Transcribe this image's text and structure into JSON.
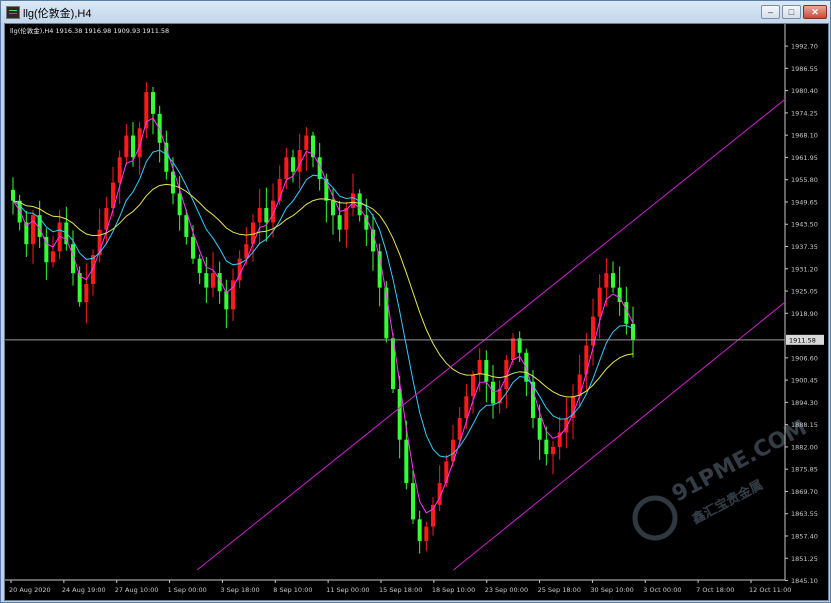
{
  "window": {
    "title": "llg(伦敦金),H4",
    "controls": {
      "minimize": "–",
      "maximize": "□",
      "close": "✕"
    }
  },
  "chart_info": "llg(伦敦金),H4  1916.38 1916.98 1909.93 1911.58",
  "current_price_label": "1911.58",
  "watermark": {
    "brand": "91PME.COM",
    "sub": "鑫汇宝贵金属"
  },
  "colors": {
    "bull": "#ff1a1a",
    "bear": "#33ff33",
    "ma_fast": "#ff33ff",
    "ma_mid": "#33ccff",
    "ma_slow": "#e6e64d",
    "channel": "#cc22cc",
    "price_line": "#9a9a9a"
  },
  "chart_data": {
    "type": "candlestick",
    "symbol": "llg(伦敦金)",
    "timeframe": "H4",
    "ohlc_last": {
      "open": 1916.38,
      "high": 1916.98,
      "low": 1909.93,
      "close": 1911.58
    },
    "ylim": [
      1845.25,
      1998.25
    ],
    "y_ticks": [
      1992.7,
      1986.55,
      1980.4,
      1974.25,
      1968.1,
      1961.95,
      1955.8,
      1949.65,
      1943.5,
      1937.35,
      1931.2,
      1925.05,
      1918.9,
      1906.6,
      1900.45,
      1894.3,
      1888.15,
      1882.0,
      1875.85,
      1869.7,
      1863.55,
      1857.4,
      1851.25,
      1845.1
    ],
    "y_tick_labels": [
      "1992.70",
      "1986.55",
      "1980.40",
      "1974.25",
      "1968.10",
      "1961.95",
      "1955.80",
      "1949.65",
      "1943.50",
      "1937.35",
      "1931.20",
      "1925.05",
      "1918.90",
      "1906.60",
      "1900.45",
      "1894.30",
      "1888.15",
      "1882.00",
      "1875.85",
      "1869.70",
      "1863.55",
      "1857.40",
      "1851.25",
      "1845.10"
    ],
    "x_labels": [
      "20 Aug 2020",
      "24 Aug 19:00",
      "27 Aug 10:00",
      "1 Sep 00:00",
      "3 Sep 18:00",
      "8 Sep 10:00",
      "11 Sep 00:00",
      "15 Sep 18:00",
      "18 Sep 10:00",
      "23 Sep 00:00",
      "25 Sep 18:00",
      "30 Sep 10:00",
      "3 Oct 00:00",
      "7 Oct 18:00",
      "12 Oct 11:00"
    ],
    "closes": [
      1950,
      1944,
      1938,
      1946,
      1940,
      1933,
      1936,
      1944,
      1938,
      1930,
      1922,
      1927,
      1935,
      1942,
      1948,
      1955,
      1962,
      1968,
      1962,
      1970,
      1980,
      1974,
      1966,
      1958,
      1952,
      1946,
      1940,
      1934,
      1930,
      1926,
      1930,
      1925,
      1920,
      1928,
      1934,
      1938,
      1944,
      1948,
      1944,
      1950,
      1956,
      1962,
      1958,
      1964,
      1968,
      1962,
      1956,
      1950,
      1946,
      1942,
      1948,
      1952,
      1946,
      1942,
      1936,
      1926,
      1912,
      1898,
      1884,
      1872,
      1862,
      1856,
      1860,
      1866,
      1872,
      1878,
      1884,
      1890,
      1896,
      1902,
      1906,
      1900,
      1894,
      1898,
      1906,
      1912,
      1908,
      1900,
      1890,
      1884,
      1880,
      1882,
      1886,
      1890,
      1896,
      1902,
      1910,
      1918,
      1926,
      1930,
      1926,
      1922,
      1916,
      1911.58
    ],
    "ma_periods": [
      "fast",
      "mid",
      "slow"
    ],
    "channel": {
      "upper": [
        [
          1848,
          0.0
        ],
        [
          1978,
          1.0
        ]
      ],
      "lower": [
        [
          1848,
          0.48
        ],
        [
          1922,
          1.0
        ]
      ]
    },
    "grid": false
  }
}
